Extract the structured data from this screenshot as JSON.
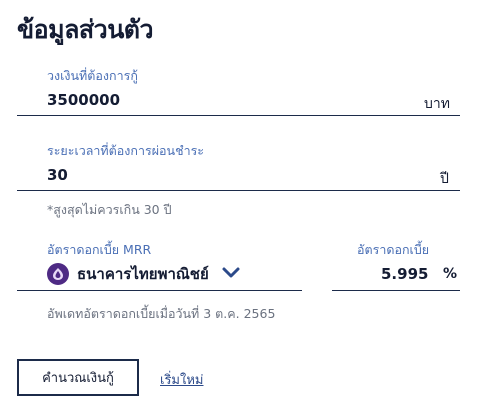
{
  "page": {
    "title": "ข้อมูลส่วนตัว"
  },
  "loan_amount": {
    "label": "วงเงินที่ต้องการกู้",
    "value": "3500000",
    "unit": "บาท"
  },
  "loan_term": {
    "label": "ระยะเวลาที่ต้องการผ่อนชำระ",
    "value": "30",
    "unit": "ปี",
    "note": "*สูงสุดไม่ควรเกิน 30 ปี"
  },
  "mrr": {
    "label": "อัตราดอกเบี้ย MRR",
    "bank": "ธนาคารไทยพาณิชย์",
    "brand_color": "#4e2a84"
  },
  "interest": {
    "label": "อัตราดอกเบี้ย",
    "value": "5.995",
    "unit": "%"
  },
  "update_note": "อัพเดทอัตราดอกเบี้ยเมื่อวันที่ 3 ต.ค. 2565",
  "actions": {
    "calculate_label": "คำนวณเงินกู้",
    "reset_label": "เริ่มใหม่"
  }
}
